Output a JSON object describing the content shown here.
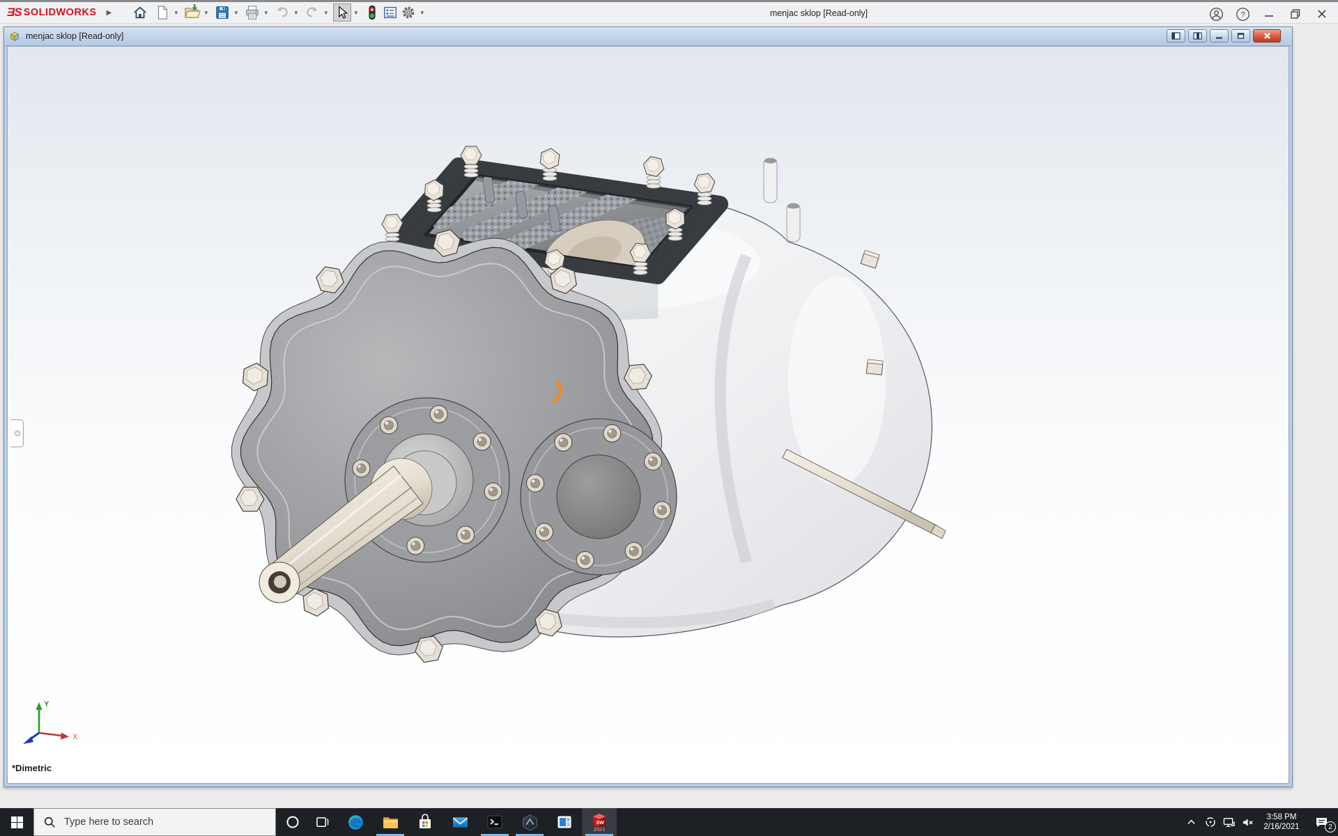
{
  "app_titlebar": {
    "brand": "SOLIDWORKS",
    "title": "menjac sklop [Read-only]",
    "toolbar_icons": [
      "home",
      "new-document",
      "open",
      "save",
      "print",
      "undo",
      "redo",
      "select-arrow",
      "rebuild-stoplight",
      "task-report",
      "options-gear"
    ],
    "right_icons": [
      "account",
      "help",
      "minimize",
      "restore",
      "close"
    ]
  },
  "document_window": {
    "title": "menjac sklop [Read-only]",
    "icon": "assembly-document",
    "window_buttons": [
      "pane-left",
      "pane-right",
      "minimize",
      "restore",
      "close"
    ],
    "view_label": "*Dimetric",
    "triad": {
      "x": "X",
      "y": "Y"
    }
  },
  "taskbar": {
    "search_placeholder": "Type here to search",
    "buttons": [
      "start",
      "search",
      "cortana",
      "task-view"
    ],
    "apps": [
      "edge",
      "file-explorer",
      "store",
      "mail",
      "command-prompt",
      "hexagon-app",
      "panels-app",
      "solidworks-2021"
    ],
    "open_apps": [
      "file-explorer",
      "command-prompt",
      "hexagon-app",
      "solidworks-2021"
    ],
    "active_app": "solidworks-2021",
    "solidworks_year": "2021",
    "tray_icons": [
      "hidden-icons-chevron",
      "update-circle",
      "network",
      "volume-muted",
      "clock",
      "action-center"
    ],
    "tray": {
      "time": "3:58 PM",
      "date": "2/16/2021",
      "notification_count": "2"
    }
  },
  "colors": {
    "solidworks_red": "#d6121b",
    "selection_orange": "#f28b16",
    "taskbar_underline": "#76b9ed",
    "doc_frame_blue": "#b9cde5"
  }
}
